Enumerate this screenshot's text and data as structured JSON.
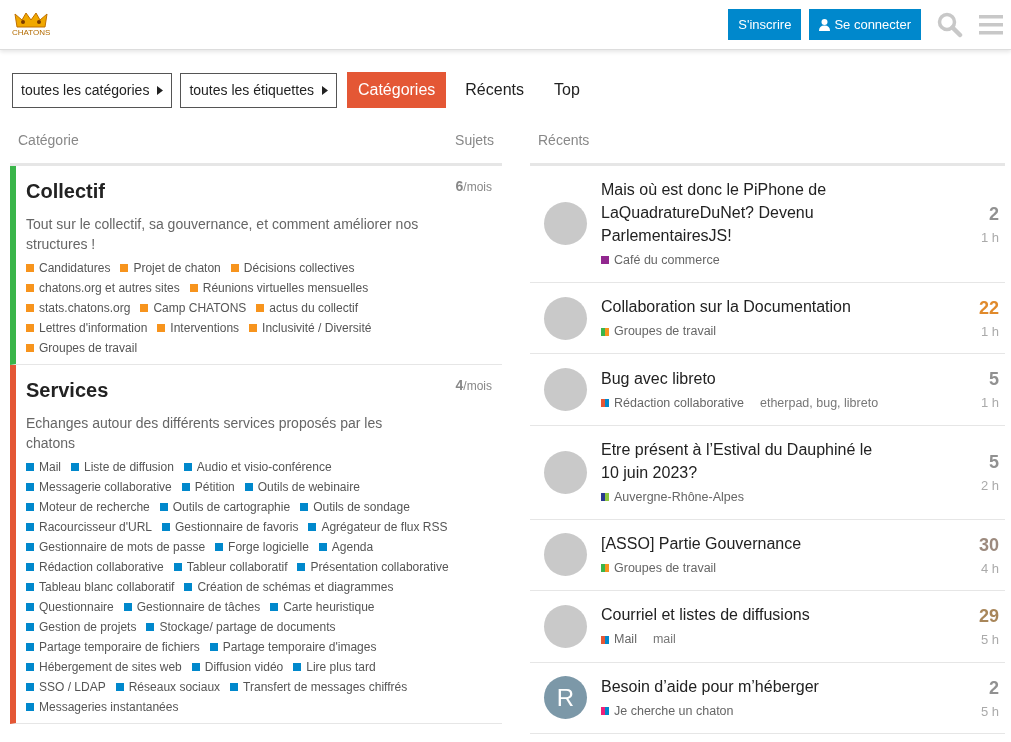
{
  "header": {
    "signup": "S'inscrire",
    "login": "Se connecter",
    "logo_text": "CHATONS"
  },
  "nav": {
    "dropdowns": [
      "toutes les catégories",
      "toutes les étiquettes"
    ],
    "tabs": [
      {
        "label": "Catégories",
        "selected": true
      },
      {
        "label": "Récents",
        "selected": false
      },
      {
        "label": "Top",
        "selected": false
      }
    ]
  },
  "categories_table": {
    "columns": [
      "Catégorie",
      "Sujets"
    ],
    "rows": [
      {
        "name": "Collectif",
        "color": "#3ab54a",
        "count": "6",
        "unit": "/mois",
        "description": "Tout sur le collectif, sa gouvernance, et comment améliorer nos structures !",
        "subcategories": [
          {
            "name": "Candidatures",
            "color": "#f7941d"
          },
          {
            "name": "Projet de chaton",
            "color": "#f7941d"
          },
          {
            "name": "Décisions collectives",
            "color": "#f7941d"
          },
          {
            "name": "chatons.org et autres sites",
            "color": "#f7941d"
          },
          {
            "name": "Réunions virtuelles mensuelles",
            "color": "#f7941d"
          },
          {
            "name": "stats.chatons.org",
            "color": "#f7941d"
          },
          {
            "name": "Camp CHATONS",
            "color": "#f7941d"
          },
          {
            "name": "actus du collectif",
            "color": "#f7941d"
          },
          {
            "name": "Lettres d'information",
            "color": "#f7941d"
          },
          {
            "name": "Interventions",
            "color": "#f7941d"
          },
          {
            "name": "Inclusivité / Diversité",
            "color": "#f7941d"
          },
          {
            "name": "Groupes de travail",
            "color": "#f7941d"
          }
        ]
      },
      {
        "name": "Services",
        "color": "#e45735",
        "count": "4",
        "unit": "/mois",
        "description": "Echanges autour des différents services proposés par les chatons",
        "subcategories": [
          {
            "name": "Mail",
            "color": "#0088cc"
          },
          {
            "name": "Liste de diffusion",
            "color": "#0088cc"
          },
          {
            "name": "Audio et visio-conférence",
            "color": "#0088cc"
          },
          {
            "name": "Messagerie collaborative",
            "color": "#0088cc"
          },
          {
            "name": "Pétition",
            "color": "#0088cc"
          },
          {
            "name": "Outils de webinaire",
            "color": "#0088cc"
          },
          {
            "name": "Moteur de recherche",
            "color": "#0088cc"
          },
          {
            "name": "Outils de cartographie",
            "color": "#0088cc"
          },
          {
            "name": "Outils de sondage",
            "color": "#0088cc"
          },
          {
            "name": "Racourcisseur d'URL",
            "color": "#0088cc"
          },
          {
            "name": "Gestionnaire de favoris",
            "color": "#0088cc"
          },
          {
            "name": "Agrégateur de flux RSS",
            "color": "#0088cc"
          },
          {
            "name": "Gestionnaire de mots de passe",
            "color": "#0088cc"
          },
          {
            "name": "Forge logicielle",
            "color": "#0088cc"
          },
          {
            "name": "Agenda",
            "color": "#0088cc"
          },
          {
            "name": "Rédaction collaborative",
            "color": "#0088cc"
          },
          {
            "name": "Tableur collaboratif",
            "color": "#0088cc"
          },
          {
            "name": "Présentation collaborative",
            "color": "#0088cc"
          },
          {
            "name": "Tableau blanc collaboratif",
            "color": "#0088cc"
          },
          {
            "name": "Création de schémas et diagrammes",
            "color": "#0088cc"
          },
          {
            "name": "Questionnaire",
            "color": "#0088cc"
          },
          {
            "name": "Gestionnaire de tâches",
            "color": "#0088cc"
          },
          {
            "name": "Carte heuristique",
            "color": "#0088cc"
          },
          {
            "name": "Gestion de projets",
            "color": "#0088cc"
          },
          {
            "name": "Stockage/ partage de documents",
            "color": "#0088cc"
          },
          {
            "name": "Partage temporaire de fichiers",
            "color": "#0088cc"
          },
          {
            "name": "Partage temporaire d'images",
            "color": "#0088cc"
          },
          {
            "name": "Hébergement de sites web",
            "color": "#0088cc"
          },
          {
            "name": "Diffusion vidéo",
            "color": "#0088cc"
          },
          {
            "name": "Lire plus tard",
            "color": "#0088cc"
          },
          {
            "name": "SSO / LDAP",
            "color": "#0088cc"
          },
          {
            "name": "Réseaux sociaux",
            "color": "#0088cc"
          },
          {
            "name": "Transfert de messages chiffrés",
            "color": "#0088cc"
          },
          {
            "name": "Messageries instantanées",
            "color": "#0088cc"
          }
        ]
      }
    ]
  },
  "recent": {
    "heading": "Récents",
    "topics": [
      {
        "title": "Mais où est donc le PiPhone de LaQuadratureDuNet? Devenu ParlementairesJS!",
        "avatar": {
          "kind": "image"
        },
        "parent_category": {
          "color": "#92278f"
        },
        "category": {
          "name": "Café du commerce",
          "color": "#92278f"
        },
        "replies": {
          "text": "2",
          "color": "#919191"
        },
        "age": "1 h"
      },
      {
        "title": "Collaboration sur la Documentation",
        "avatar": {
          "kind": "image"
        },
        "parent_category": {
          "color": "#3ab54a"
        },
        "category": {
          "name": "Groupes de travail",
          "color": "#f7941d"
        },
        "replies": {
          "text": "22",
          "color": "#e08a2c"
        },
        "age": "1 h"
      },
      {
        "title": "Bug avec libreto",
        "avatar": {
          "kind": "image"
        },
        "parent_category": {
          "color": "#e45735"
        },
        "category": {
          "name": "Rédaction collaborative",
          "color": "#0088cc"
        },
        "tags": "etherpad, bug, libreto",
        "replies": {
          "text": "5",
          "color": "#919191"
        },
        "age": "1 h"
      },
      {
        "title": "Etre présent à l’Estival du Dauphiné le 10 juin 2023?",
        "avatar": {
          "kind": "image"
        },
        "parent_category": {
          "color": "#2b3990"
        },
        "category": {
          "name": "Auvergne-Rhône-Alpes",
          "color": "#8dc63f"
        },
        "replies": {
          "text": "5",
          "color": "#919191"
        },
        "age": "2 h"
      },
      {
        "title": "[ASSO] Partie Gouvernance",
        "avatar": {
          "kind": "image"
        },
        "parent_category": {
          "color": "#3ab54a"
        },
        "category": {
          "name": "Groupes de travail",
          "color": "#f7941d"
        },
        "replies": {
          "text": "30",
          "color": "#9c8a7e"
        },
        "age": "4 h"
      },
      {
        "title": "Courriel et listes de diffusions",
        "avatar": {
          "kind": "image"
        },
        "parent_category": {
          "color": "#e45735"
        },
        "category": {
          "name": "Mail",
          "color": "#0088cc"
        },
        "tags": "mail",
        "replies": {
          "text": "29",
          "color": "#a8865a"
        },
        "age": "5 h"
      },
      {
        "title": "Besoin d’aide pour m’héberger",
        "avatar": {
          "kind": "letter",
          "letter": "R"
        },
        "parent_category": {
          "color": "#ed207b"
        },
        "category": {
          "name": "Je cherche un chaton",
          "color": "#0088cc"
        },
        "replies": {
          "text": "2",
          "color": "#919191"
        },
        "age": "5 h"
      }
    ]
  }
}
